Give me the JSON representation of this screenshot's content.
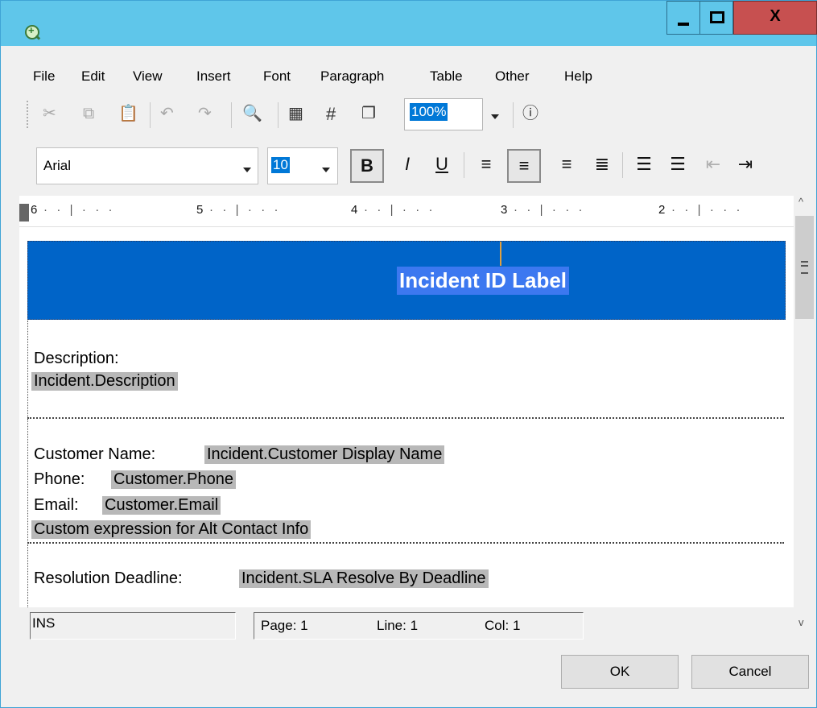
{
  "window": {
    "close_glyph": "X"
  },
  "menu": [
    "File",
    "Edit",
    "View",
    "Insert",
    "Font",
    "Paragraph",
    "Table",
    "Other",
    "Help"
  ],
  "toolbar": {
    "zoom": "100%",
    "font_name": "Arial",
    "font_size": "10",
    "bold_glyph": "B",
    "italic_glyph": "I",
    "underline_glyph": "U",
    "hash_glyph": "#"
  },
  "ruler": {
    "labels": [
      "6",
      "5",
      "4",
      "3",
      "2"
    ]
  },
  "document": {
    "banner_label": "Incident ID Label",
    "description_label": "Description:",
    "description_field": "Incident.Description",
    "customer_name_label": "Customer Name:",
    "customer_name_field": "Incident.Customer Display Name",
    "phone_label": "Phone:",
    "phone_field": "Customer.Phone",
    "email_label": "Email:",
    "email_field": "Customer.Email",
    "alt_contact_field": "Custom expression for Alt Contact Info",
    "resolution_label": "Resolution Deadline:",
    "resolution_field": "Incident.SLA Resolve By Deadline"
  },
  "status": {
    "mode": "INS",
    "page": "Page: 1",
    "line": "Line: 1",
    "col": "Col: 1"
  },
  "buttons": {
    "ok": "OK",
    "cancel": "Cancel"
  },
  "colors": {
    "titlebar": "#5fc6ea",
    "close": "#c75050",
    "banner": "#0064c8",
    "selection": "#0078d7"
  }
}
